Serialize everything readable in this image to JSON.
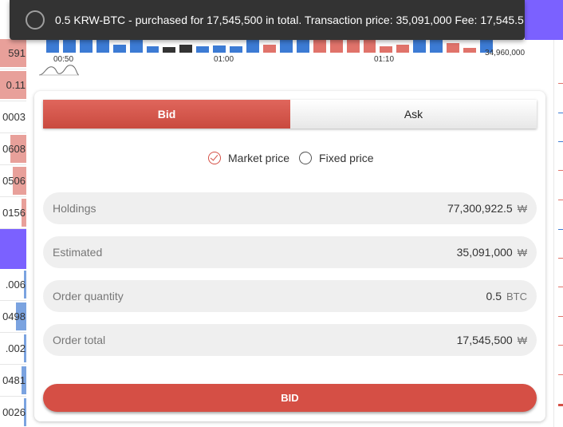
{
  "toast": {
    "message": "0.5 KRW-BTC - purchased for 17,545,500 in total. Transaction price: 35,091,000 Fee: 17,545.5"
  },
  "chart": {
    "time_labels": [
      "00:50",
      "01:00",
      "01:10"
    ],
    "price_label": "34,960,000",
    "colors": {
      "up": "#3c7bd4",
      "down": "#e0736a",
      "neutral": "#333333"
    }
  },
  "orderbook": {
    "rows": [
      {
        "text": "591",
        "side": "ask"
      },
      {
        "text": "0.11",
        "side": "ask"
      },
      {
        "text": "0003",
        "side": "ask"
      },
      {
        "text": "0608",
        "side": "ask"
      },
      {
        "text": "0506",
        "side": "ask"
      },
      {
        "text": "0156",
        "side": "ask"
      },
      {
        "text": ".006",
        "side": "bid"
      },
      {
        "text": "0498",
        "side": "bid"
      },
      {
        "text": ".002",
        "side": "bid"
      },
      {
        "text": "0481",
        "side": "bid"
      },
      {
        "text": "0026",
        "side": "bid"
      }
    ]
  },
  "trade": {
    "tabs": {
      "bid": "Bid",
      "ask": "Ask"
    },
    "price_type": {
      "market": "Market price",
      "fixed": "Fixed price",
      "selected": "market"
    },
    "fields": {
      "holdings": {
        "label": "Holdings",
        "value": "77,300,922.5",
        "unit": "₩"
      },
      "estimated": {
        "label": "Estimated",
        "value": "35,091,000",
        "unit": "₩"
      },
      "quantity": {
        "label": "Order quantity",
        "value": "0.5",
        "unit": "BTC"
      },
      "total": {
        "label": "Order total",
        "value": "17,545,500",
        "unit": "₩"
      }
    },
    "submit_label": "BID",
    "accent_color": "#d54f45"
  }
}
